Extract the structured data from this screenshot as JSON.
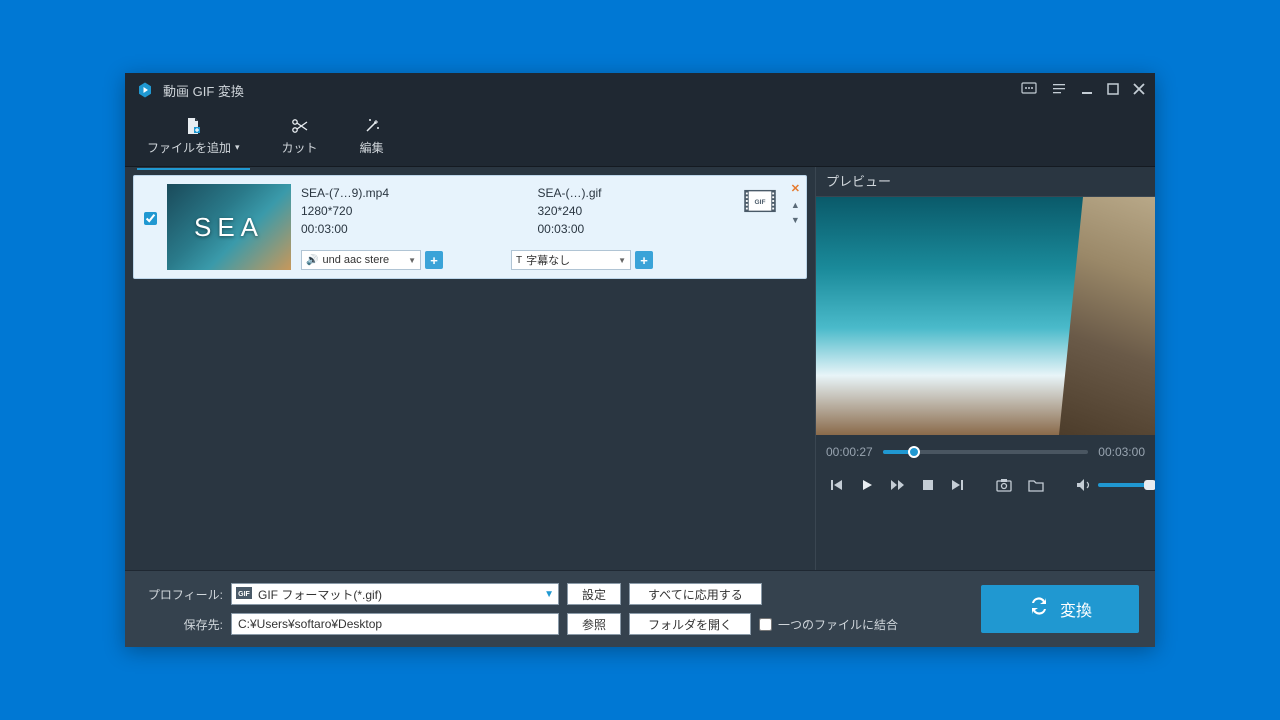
{
  "titlebar": {
    "title": "動画 GIF 変換"
  },
  "toolbar": {
    "add_file": "ファイルを追加",
    "cut": "カット",
    "edit": "編集"
  },
  "file": {
    "thumb_text": "SEA",
    "source": {
      "name": "SEA-(7…9).mp4",
      "res": "1280*720",
      "dur": "00:03:00"
    },
    "output": {
      "name": "SEA-(…).gif",
      "res": "320*240",
      "dur": "00:03:00"
    },
    "audio_select": "und aac stere",
    "subtitle_select": "字幕なし"
  },
  "preview": {
    "header": "プレビュー",
    "pos": "00:00:27",
    "total": "00:03:00"
  },
  "bottom": {
    "profile_label": "プロフィール:",
    "profile_value": "GIF フォーマット(*.gif)",
    "settings": "設定",
    "apply_all": "すべてに応用する",
    "save_label": "保存先:",
    "save_path": "C:¥Users¥softaro¥Desktop",
    "browse": "参照",
    "open_folder": "フォルダを開く",
    "merge": "一つのファイルに結合",
    "convert": "変換"
  }
}
